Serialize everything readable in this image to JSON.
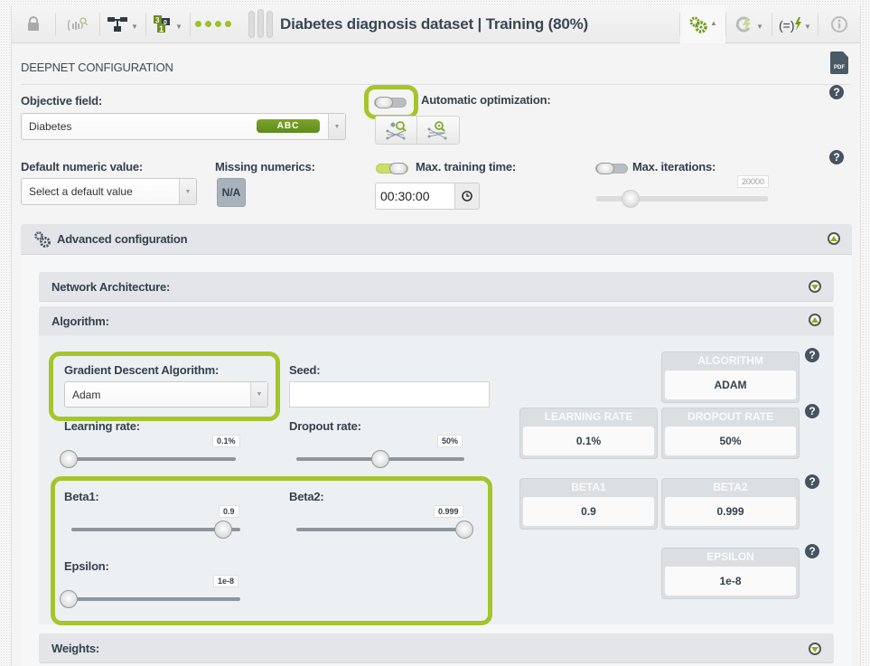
{
  "toolbar": {
    "title": "Diabetes diagnosis dataset | Training (80%)",
    "icons": [
      "lock-icon",
      "dataset-search-icon",
      "tree-icon",
      "counter-icon",
      "progress-dots-icon",
      "configure-gears-icon",
      "optiml-icon",
      "formula-icon",
      "info-icon"
    ],
    "accent": "#9bc228"
  },
  "header": {
    "section_title": "DEEPNET CONFIGURATION",
    "pdf_label": "PDF"
  },
  "objective": {
    "label": "Objective field:",
    "value": "Diabetes",
    "type_badge": "ABC"
  },
  "auto_opt": {
    "label": "Automatic optimization:",
    "enabled": false
  },
  "default_numeric": {
    "label": "Default numeric value:",
    "placeholder": "Select a default value"
  },
  "missing_numerics": {
    "label": "Missing numerics:",
    "button": "N/A"
  },
  "max_time": {
    "label": "Max. training time:",
    "enabled": true,
    "value": "00:30:00"
  },
  "max_iter": {
    "label": "Max. iterations:",
    "enabled": false,
    "value": "20000"
  },
  "advanced": {
    "title": "Advanced configuration",
    "sections": {
      "network": "Network Architecture:",
      "algorithm": "Algorithm:",
      "weights": "Weights:"
    }
  },
  "algorithm": {
    "gda_label": "Gradient Descent Algorithm:",
    "gda_value": "Adam",
    "seed_label": "Seed:",
    "seed_value": "",
    "learning_rate": {
      "label": "Learning rate:",
      "value": "0.1%",
      "fraction": 0.0
    },
    "dropout_rate": {
      "label": "Dropout rate:",
      "value": "50%",
      "fraction": 0.5
    },
    "beta1": {
      "label": "Beta1:",
      "value": "0.9",
      "fraction": 0.9
    },
    "beta2": {
      "label": "Beta2:",
      "value": "0.999",
      "fraction": 1.0
    },
    "epsilon": {
      "label": "Epsilon:",
      "value": "1e-8",
      "fraction": 0.0
    }
  },
  "summary_cards": [
    {
      "header": "ALGORITHM",
      "value": "ADAM"
    },
    {
      "header": "LEARNING RATE",
      "value": "0.1%"
    },
    {
      "header": "DROPOUT RATE",
      "value": "50%"
    },
    {
      "header": "BETA1",
      "value": "0.9"
    },
    {
      "header": "BETA2",
      "value": "0.999"
    },
    {
      "header": "EPSILON",
      "value": "1e-8"
    }
  ],
  "help_label": "?"
}
